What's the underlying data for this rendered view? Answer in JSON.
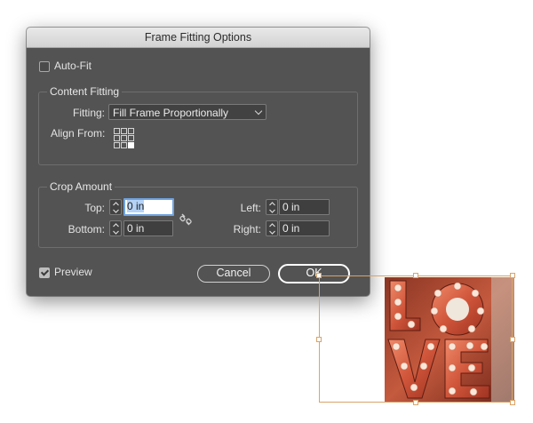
{
  "dialog": {
    "title": "Frame Fitting Options",
    "auto_fit": {
      "label": "Auto-Fit",
      "checked": false
    },
    "content_fitting": {
      "group_title": "Content Fitting",
      "fitting_label": "Fitting:",
      "fitting_value": "Fill Frame Proportionally",
      "align_from_label": "Align From:",
      "align_from_selected": "bottom-right"
    },
    "crop_amount": {
      "group_title": "Crop Amount",
      "top": {
        "label": "Top:",
        "value": "0 in",
        "focused": true
      },
      "bottom": {
        "label": "Bottom:",
        "value": "0 in"
      },
      "left": {
        "label": "Left:",
        "value": "0 in"
      },
      "right": {
        "label": "Right:",
        "value": "0 in"
      }
    },
    "preview": {
      "label": "Preview",
      "checked": true
    },
    "buttons": {
      "cancel": "Cancel",
      "ok": "OK"
    }
  },
  "canvas": {
    "selection_color": "#d9a46a",
    "photo_letters": [
      "L",
      "O",
      "V",
      "E"
    ]
  },
  "colors": {
    "dialog_bg": "#535353",
    "focus_ring": "#6fa3df",
    "marquee_light": "#c96a52"
  }
}
